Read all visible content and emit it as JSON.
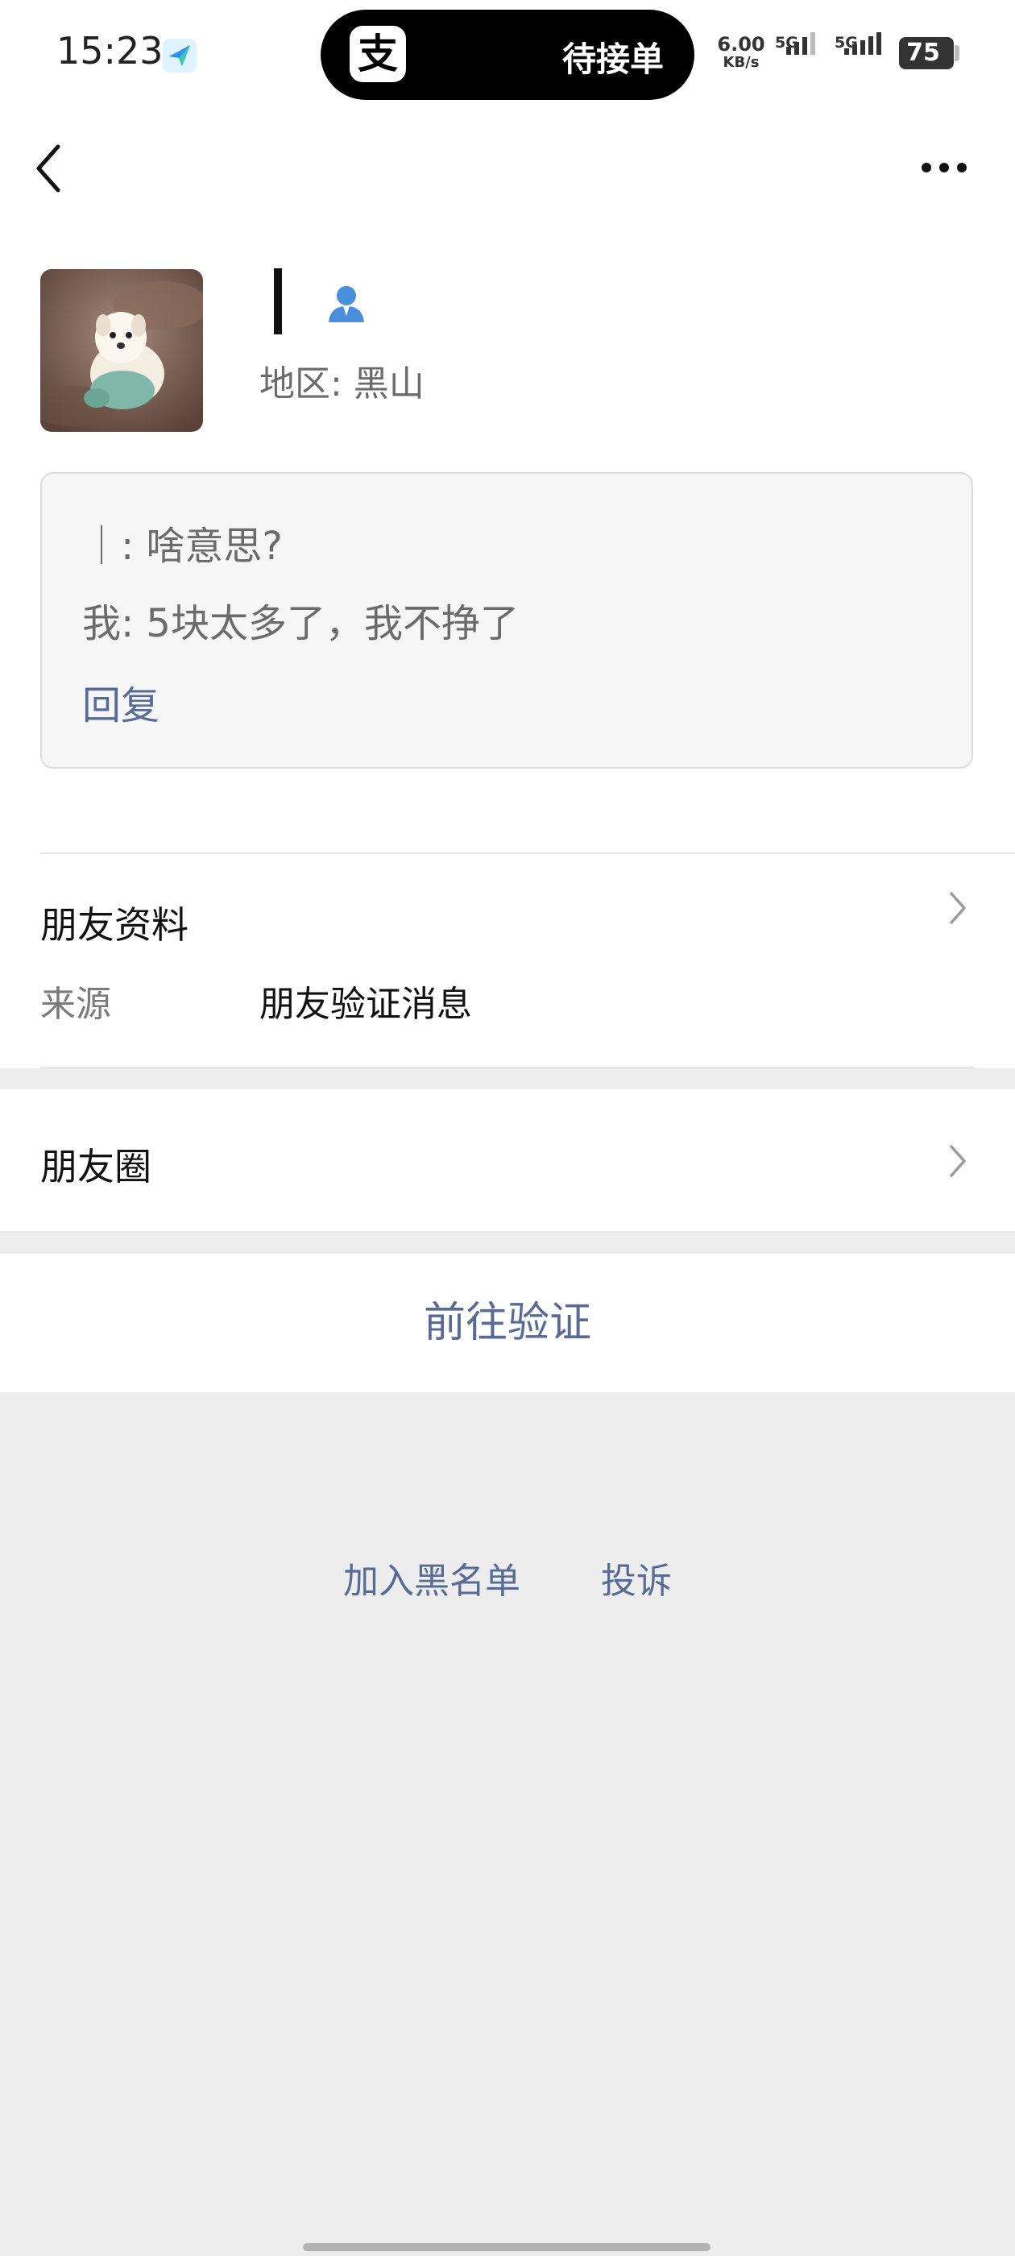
{
  "status_bar": {
    "time": "15:23",
    "island_text": "待接单",
    "island_logo": "支",
    "net_speed_value": "6.00",
    "net_speed_unit": "KB/s",
    "signal_1_label": "5G",
    "signal_2_label": "5G",
    "battery": "75"
  },
  "profile": {
    "region": "地区: 黑山"
  },
  "message": {
    "line1": "｜: 啥意思?",
    "line2": "我: 5块太多了，我不挣了",
    "reply_label": "回复"
  },
  "friend_info": {
    "title": "朋友资料",
    "source_label": "来源",
    "source_value": "朋友验证消息"
  },
  "moments": {
    "title": "朋友圈"
  },
  "verify_button": "前往验证",
  "footer": {
    "blacklist": "加入黑名单",
    "report": "投诉"
  },
  "colors": {
    "link": "#576b95",
    "background": "#ededed"
  }
}
